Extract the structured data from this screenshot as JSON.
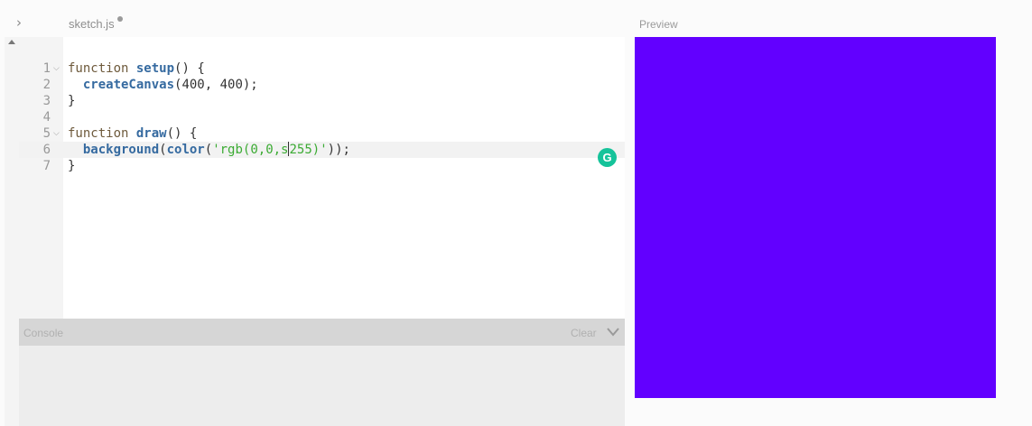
{
  "toolbar": {
    "expand_icon": "chevron-right-icon",
    "file_tab": "sketch.js",
    "unsaved_indicator": true
  },
  "preview": {
    "label": "Preview",
    "canvas_color": "#6200ff"
  },
  "editor": {
    "active_line": 6,
    "lines": [
      {
        "number": "1",
        "fold": true,
        "code": "function setup() {"
      },
      {
        "number": "2",
        "fold": false,
        "code": "  createCanvas(400, 400);"
      },
      {
        "number": "3",
        "fold": false,
        "code": "}"
      },
      {
        "number": "4",
        "fold": false,
        "code": ""
      },
      {
        "number": "5",
        "fold": true,
        "code": "function draw() {"
      },
      {
        "number": "6",
        "fold": false,
        "code": "  background(color('rgb(0,0,s255)'));"
      },
      {
        "number": "7",
        "fold": false,
        "code": "}"
      }
    ]
  },
  "grammarly": {
    "icon": "grammarly-icon",
    "color": "#15c39a",
    "glyph": "G"
  },
  "console": {
    "title": "Console",
    "clear_label": "Clear",
    "collapse_icon": "chevron-down-icon"
  }
}
